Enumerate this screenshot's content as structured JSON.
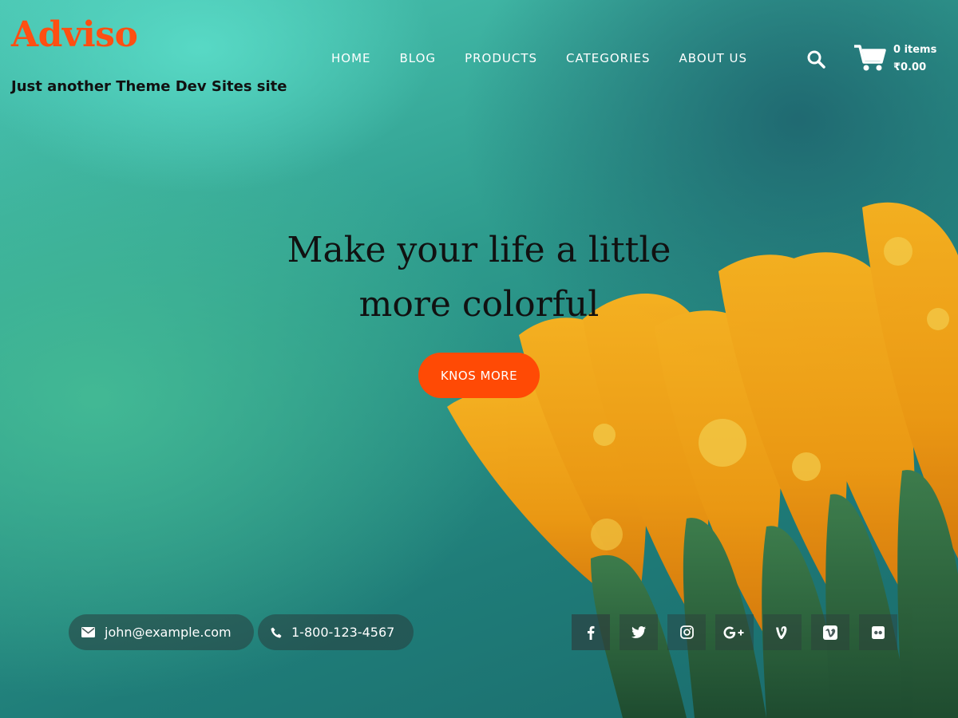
{
  "site": {
    "logo": "Adviso",
    "tagline": "Just another Theme Dev Sites site"
  },
  "nav": {
    "items": [
      "HOME",
      "BLOG",
      "PRODUCTS",
      "CATEGORIES",
      "ABOUT US"
    ]
  },
  "cart": {
    "count": "0 items",
    "total": "₹0.00"
  },
  "hero": {
    "line1": "Make your life a little",
    "line2": "more colorful",
    "button": "KNOS MORE"
  },
  "contact": {
    "email": "john@example.com",
    "phone": "1-800-123-4567"
  },
  "social": {
    "icons": [
      "facebook-icon",
      "twitter-icon",
      "instagram-icon",
      "google-plus-icon",
      "vine-icon",
      "vimeo-icon",
      "flickr-icon"
    ]
  },
  "colors": {
    "brand": "#ff4f12",
    "button": "#ff4a05",
    "text_dark": "#111111"
  }
}
